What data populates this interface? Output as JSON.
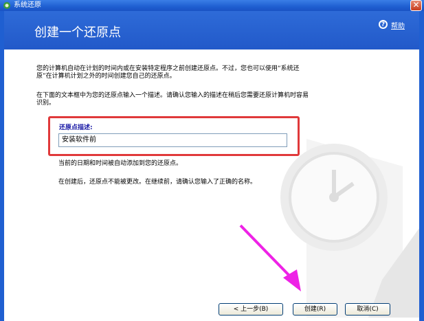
{
  "window": {
    "title": "系统还原",
    "close_glyph": "✕"
  },
  "header": {
    "title": "创建一个还原点",
    "help_link": "帮助",
    "help_glyph": "?"
  },
  "content": {
    "intro": [
      "您的计算机自动在计划的时间内或在安装特定程序之前创建还原点。不过，您也可以使用“系统还",
      "原”在计算机计划之外的时间创建您自己的还原点。"
    ],
    "instructions": [
      "在下面的文本框中为您的还原点输入一个描述。请确认您输入的描述在稍后您需要还原计算机时容易",
      "识别。"
    ],
    "description_label": "还原点描述:",
    "description_value": "安装软件前",
    "date_note": "当前的日期和时间被自动添加到您的还原点。",
    "warning": "在创建后，还原点不能被更改。在继续前，请确认您输入了正确的名称。"
  },
  "buttons": {
    "back": "< 上一步(B)",
    "create": "创建(R)",
    "cancel": "取消(C)"
  },
  "colors": {
    "titlebar": "#1f5fd1",
    "header": "#2259c9",
    "highlight_box": "#e0393a",
    "pointer_arrow": "#ee22e6"
  },
  "icons": {
    "app": "system-restore-icon",
    "help": "help-icon",
    "close": "close-icon",
    "watermark": "clock-restore-watermark"
  }
}
